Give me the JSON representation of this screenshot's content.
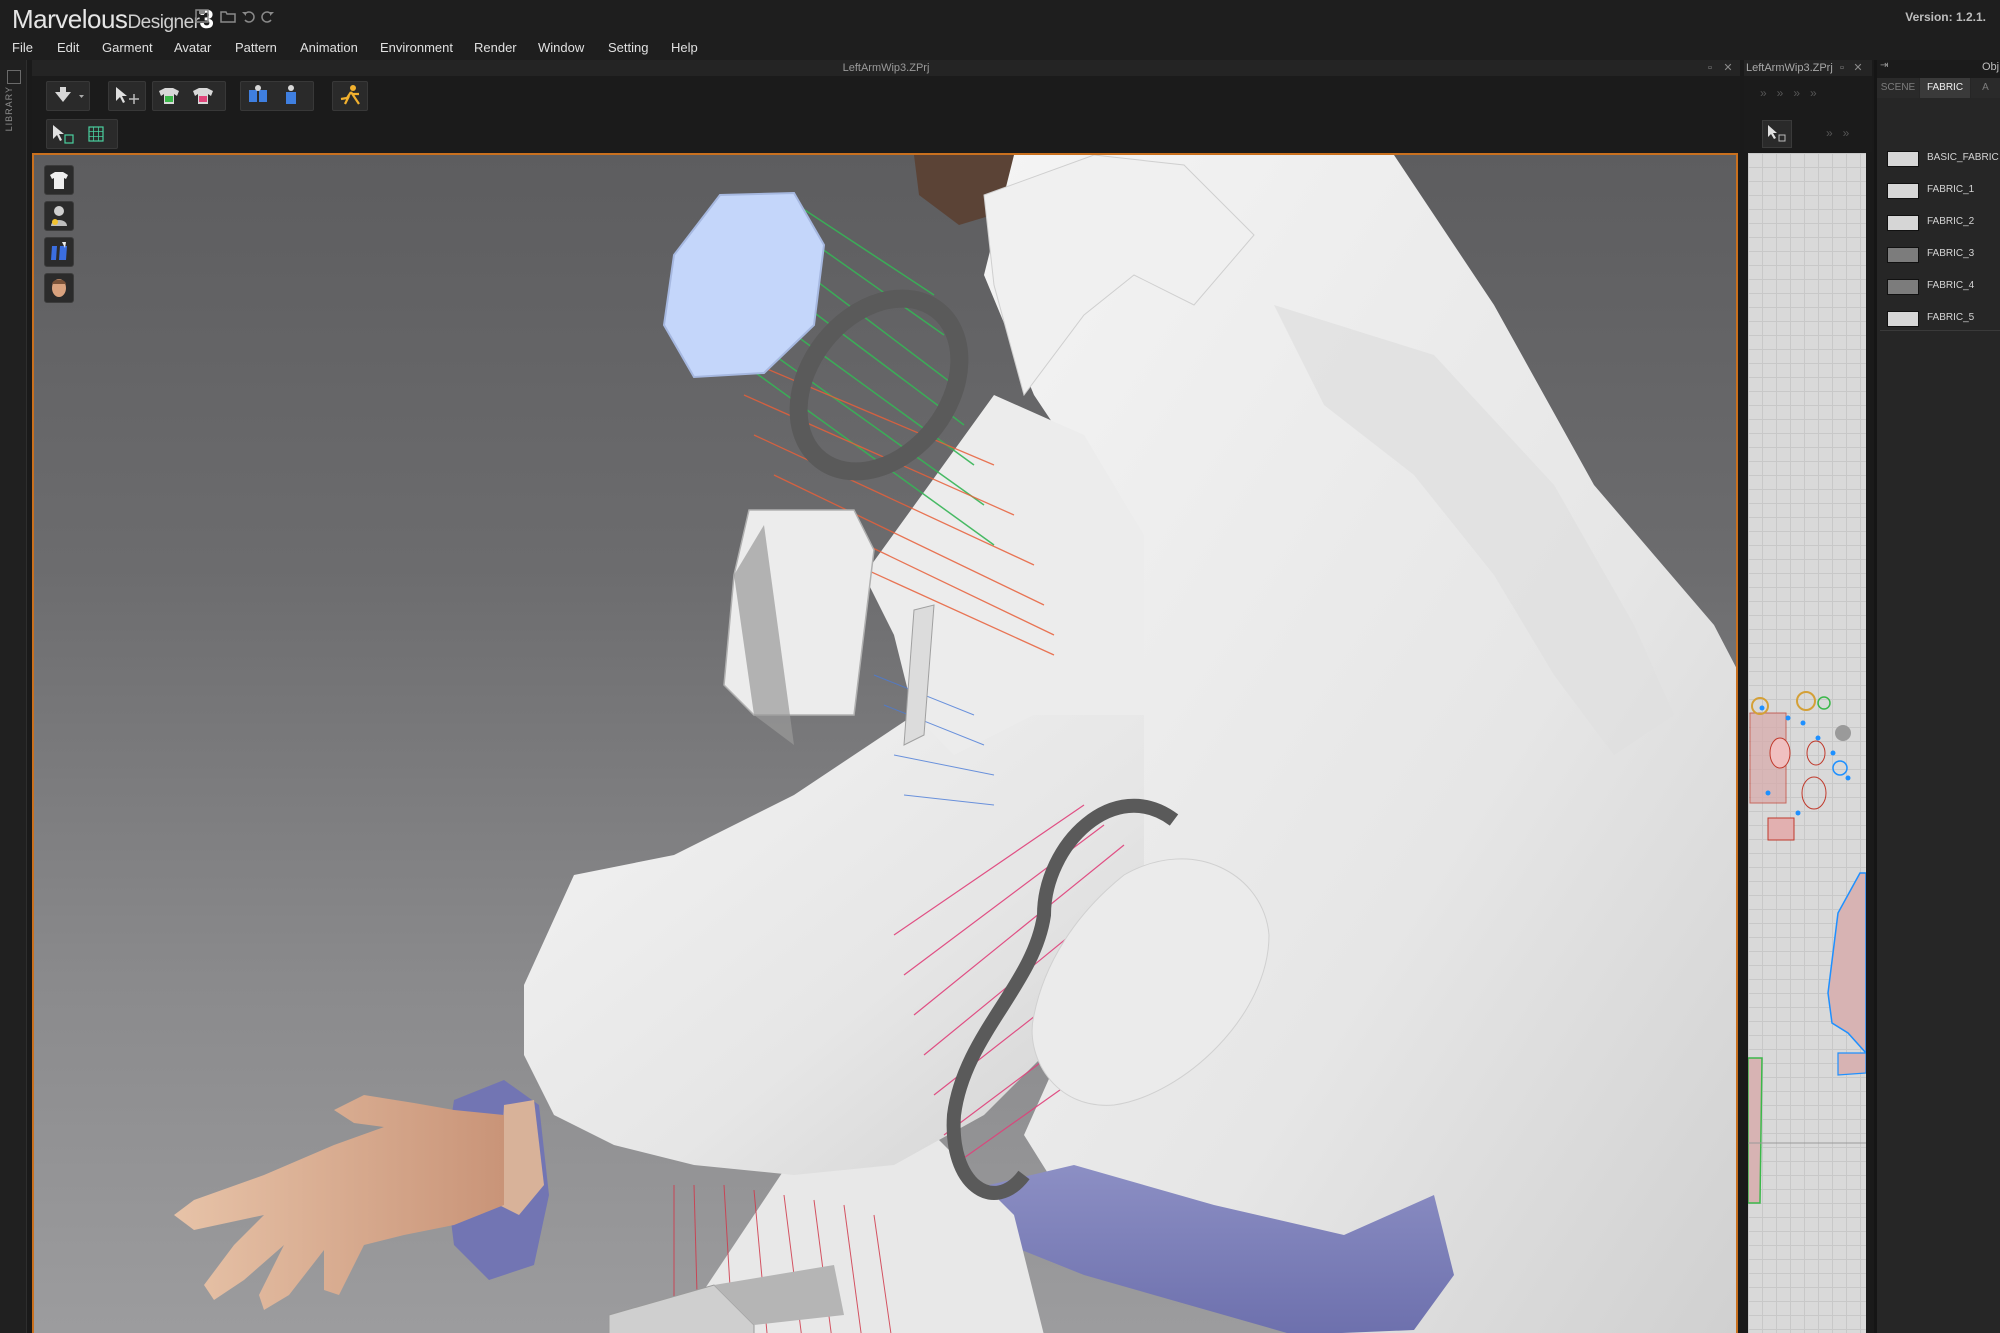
{
  "app": {
    "name_part1": "Marvelous",
    "name_part2": "Designer",
    "name_part3": "3",
    "version_text": "Version:  1.2.1.",
    "title_icons": [
      "save-icon",
      "open-icon",
      "undo-icon",
      "redo-icon"
    ]
  },
  "menu": [
    "File",
    "Edit",
    "Garment",
    "Avatar",
    "Pattern",
    "Animation",
    "Environment",
    "Render",
    "Window",
    "Setting",
    "Help"
  ],
  "library": {
    "label": "LIBRARY"
  },
  "window3d": {
    "title": "LeftArmWip3.ZPrj",
    "toolbar1_icons": [
      "move-down-icon",
      "select-move-icon",
      "garment-green-icon",
      "garment-pink-icon",
      "arrange-blue-icon",
      "arrange-figure-icon",
      "simulate-icon"
    ],
    "toolbar2_icons": [
      "select-pattern-icon",
      "select-mesh-icon"
    ],
    "viewport_buttons": [
      "show-garment-icon",
      "show-avatar-icon",
      "show-arrangement-icon",
      "show-head-icon"
    ],
    "highlight_color": "#c9701e"
  },
  "window2d": {
    "title": "LeftArmWip3.ZPrj"
  },
  "right_panel": {
    "top_label": "Obj",
    "tabs": [
      "SCENE",
      "FABRIC",
      "A"
    ],
    "active_tab": "FABRIC",
    "fabrics": [
      {
        "name": "BASIC_FABRIC",
        "color": "#d6d6d6"
      },
      {
        "name": "FABRIC_1",
        "color": "#d6d6d6"
      },
      {
        "name": "FABRIC_2",
        "color": "#d6d6d6"
      },
      {
        "name": "FABRIC_3",
        "color": "#7c7c7c"
      },
      {
        "name": "FABRIC_4",
        "color": "#7c7c7c"
      },
      {
        "name": "FABRIC_5",
        "color": "#d6d6d6"
      }
    ]
  }
}
